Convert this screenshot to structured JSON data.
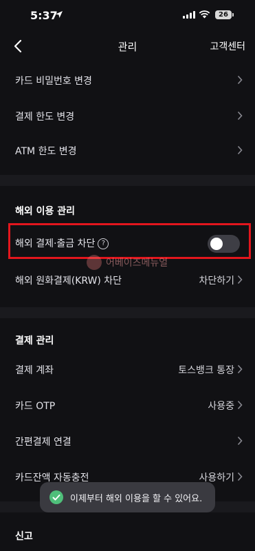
{
  "status_bar": {
    "time": "5:37",
    "battery": "26"
  },
  "nav": {
    "title": "관리",
    "right_action": "고객센터"
  },
  "top_rows": [
    {
      "label": "카드 비밀번호 변경"
    },
    {
      "label": "결제 한도 변경"
    },
    {
      "label": "ATM 한도 변경"
    }
  ],
  "overseas": {
    "title": "해외 이용 관리",
    "block_row": {
      "label": "해외 결제·출금 차단",
      "help": "?",
      "toggle_on": false
    },
    "krw_row": {
      "label": "해외 원화결제(KRW) 차단",
      "value": "차단하기"
    }
  },
  "payment": {
    "title": "결제 관리",
    "rows": [
      {
        "label": "결제 계좌",
        "value": "토스뱅크 통장"
      },
      {
        "label": "카드 OTP",
        "value": "사용중"
      },
      {
        "label": "간편결제 연결",
        "value": ""
      },
      {
        "label": "카드잔액 자동충전",
        "value": "사용하기"
      }
    ]
  },
  "report": {
    "title": "신고"
  },
  "watermark": "어베이즈메뉴얼",
  "toast": {
    "text": "이제부터 해외 이용을 할 수 있어요."
  },
  "colors": {
    "background": "#111114",
    "highlight": "#e3161d",
    "toast_check": "#4fbf7a"
  }
}
